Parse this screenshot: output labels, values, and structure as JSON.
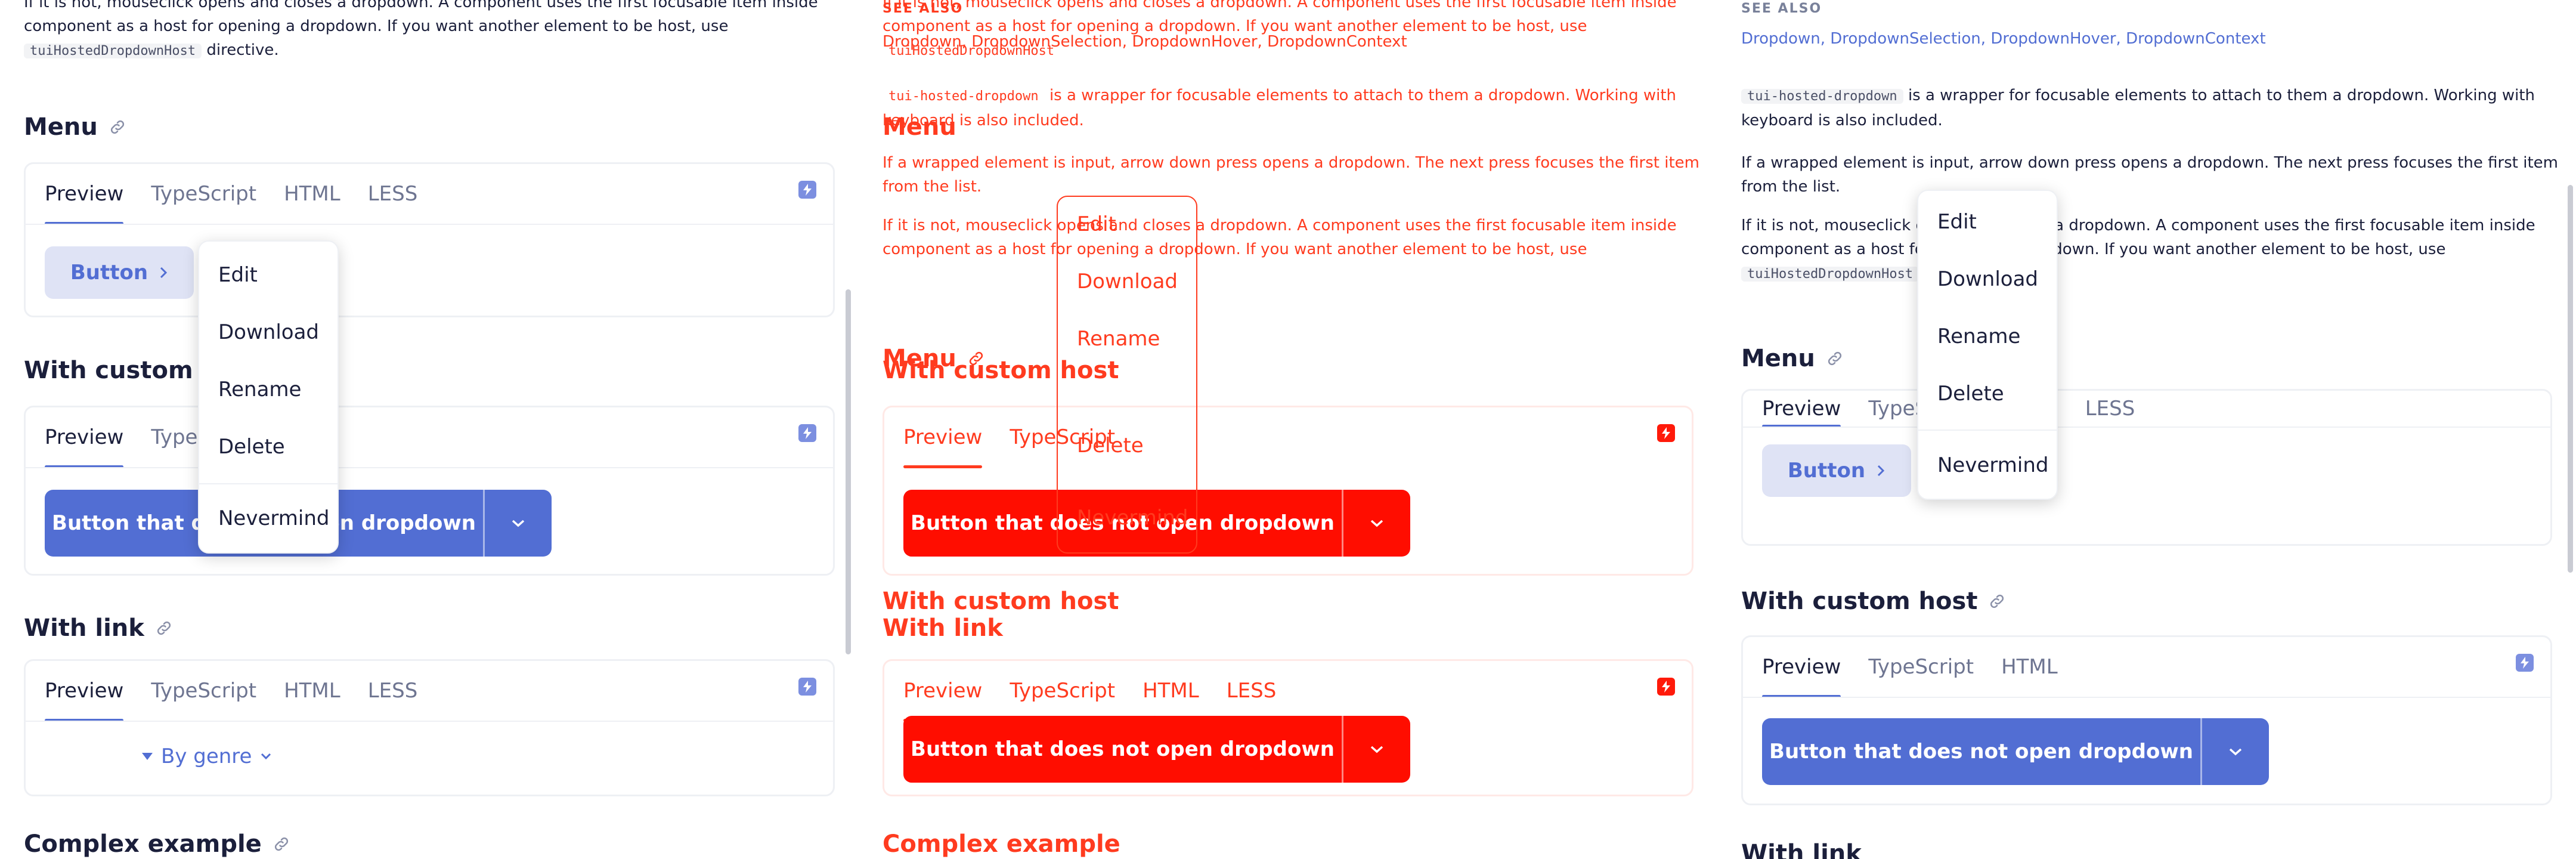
{
  "intro": {
    "p_top": "If it is not, mouseclick opens and closes a dropdown. A component uses the first focusable item inside",
    "p_mid": "component as a host for opening a dropdown. If you want another element to be host, use",
    "code": "tuiHostedDropdownHost",
    "p_end": "directive."
  },
  "see_also": {
    "label": "SEE ALSO",
    "links": [
      "Dropdown",
      "DropdownSelection",
      "DropdownHover",
      "DropdownContext"
    ]
  },
  "description": {
    "code": "tui-hosted-dropdown",
    "p1": "is a wrapper for focusable elements to attach to them a dropdown. Working with",
    "p1b": "keyboard is also included.",
    "p2a": "If a wrapped element is input, arrow down press opens a dropdown. The next press focuses the first item",
    "p2b": "from the list.",
    "p3a": "If it is not, mouseclick opens and closes a dropdown. A component uses the first focusable item inside",
    "p3b": "component as a host for opening a dropdown. If you want another element to be host, use"
  },
  "sections": {
    "menu": "Menu",
    "custom_host": "With custom host",
    "with_link": "With link",
    "complex": "Complex example"
  },
  "tabs": [
    "Preview",
    "TypeScript",
    "HTML",
    "LESS"
  ],
  "buttons": {
    "menu_button": "Button",
    "no_dropdown": "Button that does not open dropdown",
    "genre": "By genre"
  },
  "dropdown_items": [
    "Edit",
    "Download",
    "Rename",
    "Delete",
    "Nevermind"
  ],
  "colors": {
    "accent": "#526ed3",
    "diff_red": "#ff0d00",
    "text": "#1b1f3b",
    "muted": "#6e7591"
  }
}
